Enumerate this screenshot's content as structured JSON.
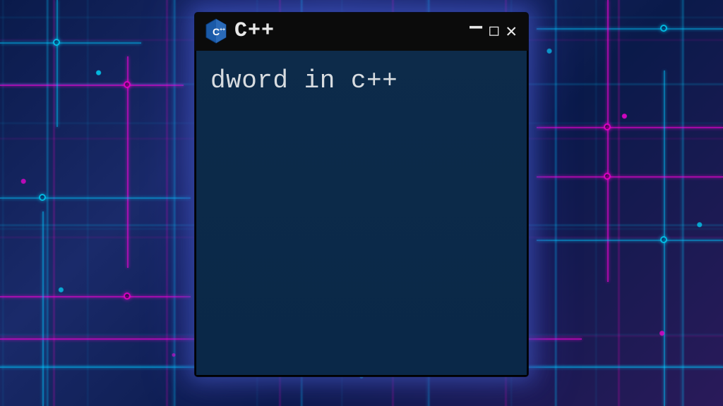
{
  "window": {
    "title": "C++",
    "icon_name": "cpp-icon"
  },
  "terminal": {
    "content": "dword in c++"
  },
  "colors": {
    "terminal_bg": "#0d2b4a",
    "titlebar_bg": "#0b0b0b",
    "text": "#d8dce0",
    "glow": "#5078ff"
  }
}
